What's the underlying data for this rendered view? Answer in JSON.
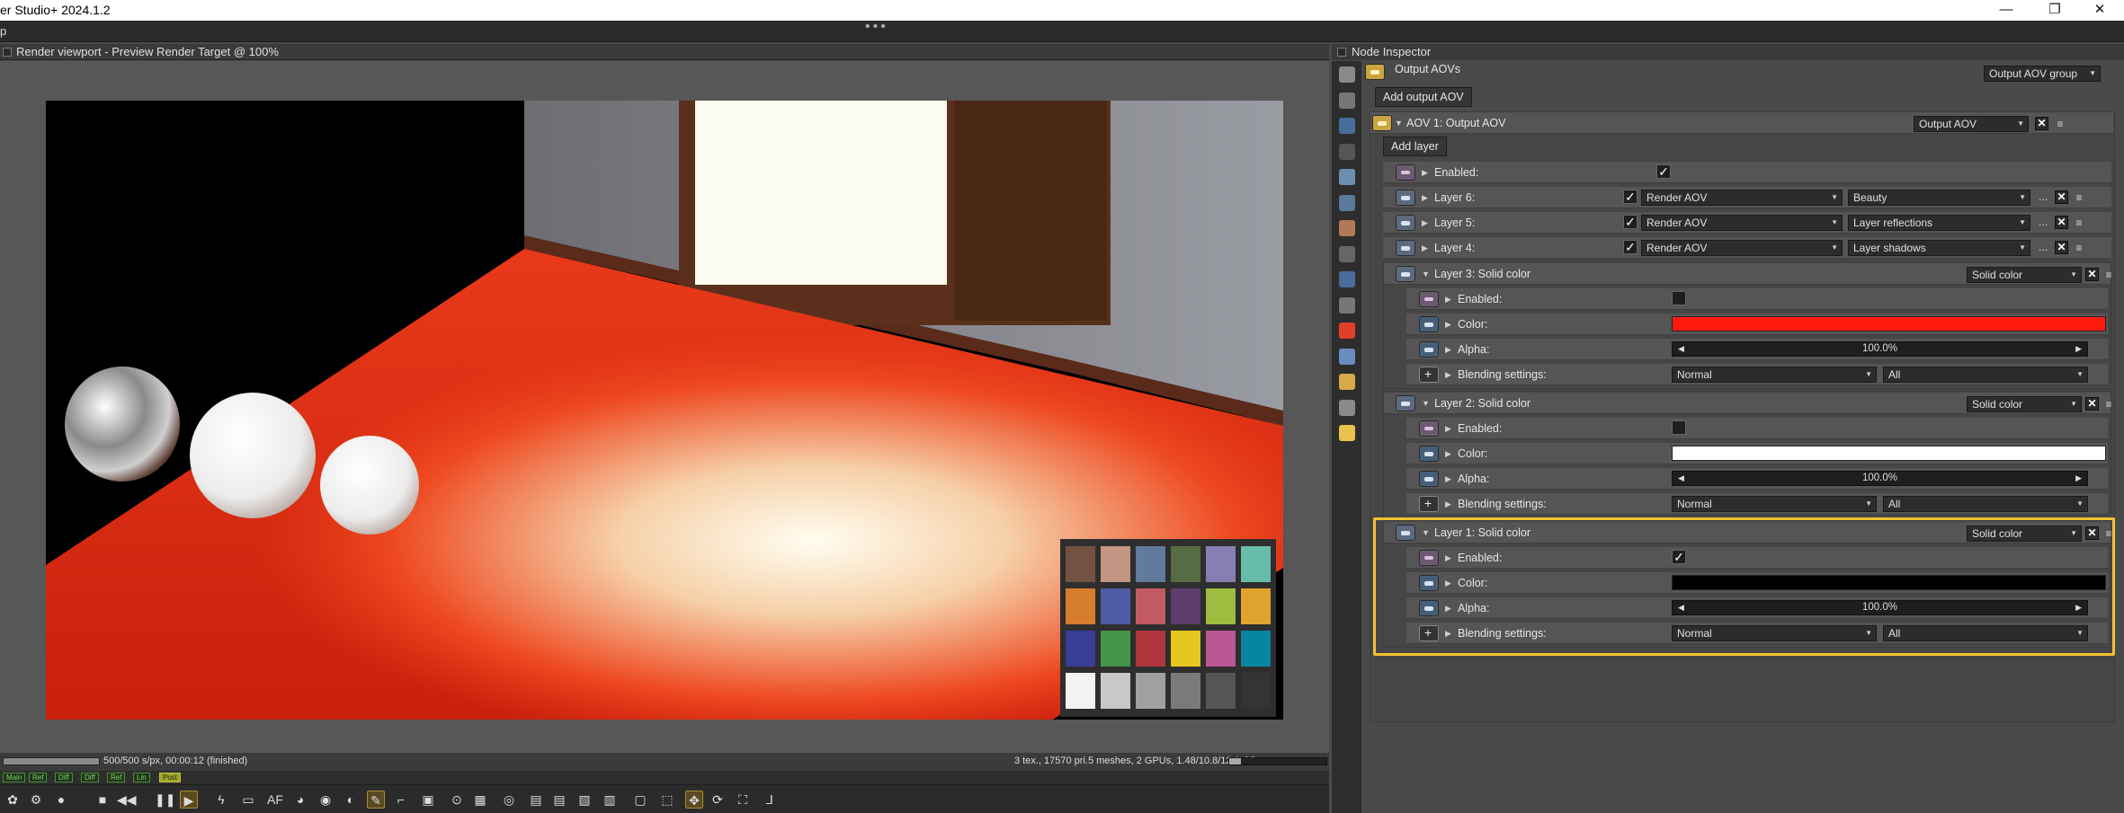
{
  "window": {
    "title": "er Studio+ 2024.1.2",
    "menu_first": "p",
    "minimize_glyph": "—",
    "restore_glyph": "❐",
    "close_glyph": "✕",
    "dots": "•••"
  },
  "viewport": {
    "title": "Render viewport - Preview Render Target @ 100%",
    "status_left": "500/500 s/px, 00:00:12 (finished)",
    "status_right": "3 tex., 17570 pri.5 meshes, 2 GPUs, 1.48/10.8/12.0 GB",
    "progress": 1.0,
    "gpu_memory_fraction": 0.12,
    "tags": [
      "Main",
      "Ref",
      "Diff",
      "Diff",
      "Ref",
      "Lin",
      "Post"
    ],
    "active_tag_index": 6,
    "toolbar_icons": [
      "palette-icon",
      "settings-icon",
      "sphere-icon",
      "stop-icon",
      "rewind-icon",
      "pause-icon",
      "play-icon",
      "lightning-icon",
      "monitor-icon",
      "af-icon",
      "color-wheel-icon",
      "rgb-icon",
      "focus-icon",
      "picker-icon",
      "crop-icon",
      "region-icon",
      "zoom-fit-icon",
      "frame-icon",
      "target-icon",
      "file-icon",
      "save-icon",
      "export-icon",
      "layer-icon",
      "lock-icon",
      "cube-icon",
      "move-icon",
      "rotate-icon",
      "fullscreen-icon",
      "axis-icon"
    ],
    "toolbar_glyphs": [
      "✿",
      "⚙",
      "●",
      "■",
      "◀◀",
      "❚❚",
      "▶",
      "ϟ",
      "▭",
      "AF",
      "◕",
      "◉",
      "◐",
      "✎",
      "⌐",
      "▣",
      "⊙",
      "▦",
      "◎",
      "▤",
      "▤",
      "▧",
      "▥",
      "▢",
      "⬚",
      "✥",
      "⟳",
      "⛶",
      "⅃"
    ],
    "active_tool_indices": [
      6,
      13,
      25
    ],
    "checker_colors": [
      "#735244",
      "#c29682",
      "#627a9d",
      "#576c43",
      "#8580b1",
      "#67bdaa",
      "#d67e2c",
      "#505ba6",
      "#c15a63",
      "#5e3c6c",
      "#9dbc40",
      "#e0a32e",
      "#383d96",
      "#469449",
      "#af363c",
      "#e7c71f",
      "#bb5695",
      "#0885a1",
      "#f3f3f2",
      "#c8c8c8",
      "#a0a0a0",
      "#7a7a79",
      "#555555",
      "#343434"
    ]
  },
  "inspector": {
    "title": "Node Inspector",
    "side_icons": [
      "layers-icon",
      "list-icon",
      "image-icon",
      "camera-icon",
      "mesh-icon",
      "geometry-icon",
      "material-icon",
      "texture-icon",
      "time-icon",
      "transform-icon",
      "red-sphere-icon",
      "blue-box-icon",
      "yellow-box-icon",
      "picture-icon",
      "light-icon"
    ],
    "output_aovs": {
      "label": "Output AOVs",
      "type": "Output AOV group",
      "add_button": "Add output AOV"
    },
    "aov1": {
      "label": "AOV 1: Output AOV",
      "type": "Output AOV",
      "add_layer": "Add layer",
      "enabled_label": "Enabled:",
      "enabled": "✓"
    },
    "layers_simple": [
      {
        "label": "Layer 6:",
        "check": "✓",
        "kind": "Render AOV",
        "value": "Beauty"
      },
      {
        "label": "Layer 5:",
        "check": "✓",
        "kind": "Render AOV",
        "value": "Layer reflections"
      },
      {
        "label": "Layer 4:",
        "check": "✓",
        "kind": "Render AOV",
        "value": "Layer shadows"
      }
    ],
    "layers_solid": [
      {
        "label": "Layer 3: Solid color",
        "type": "Solid color",
        "enabled_label": "Enabled:",
        "enabled": "",
        "color_label": "Color:",
        "color": "#ff1a10",
        "alpha_label": "Alpha:",
        "alpha": "100.0%",
        "blend_label": "Blending settings:",
        "blend_mode": "Normal",
        "blend_channels": "All"
      },
      {
        "label": "Layer 2: Solid color",
        "type": "Solid color",
        "enabled_label": "Enabled:",
        "enabled": "",
        "color_label": "Color:",
        "color": "#ffffff",
        "alpha_label": "Alpha:",
        "alpha": "100.0%",
        "blend_label": "Blending settings:",
        "blend_mode": "Normal",
        "blend_channels": "All"
      },
      {
        "label": "Layer 1: Solid color",
        "type": "Solid color",
        "enabled_label": "Enabled:",
        "enabled": "✓",
        "color_label": "Color:",
        "color": "#000000",
        "alpha_label": "Alpha:",
        "alpha": "100.0%",
        "blend_label": "Blending settings:",
        "blend_mode": "Normal",
        "blend_channels": "All"
      }
    ],
    "x_glyph": "✕",
    "menu_glyph": "≡",
    "ellipsis": "...",
    "arrow_glyph": "▼",
    "expand_glyph": "▶",
    "left_arrow": "◀",
    "right_arrow": "▶",
    "accent": "#f1c232"
  }
}
